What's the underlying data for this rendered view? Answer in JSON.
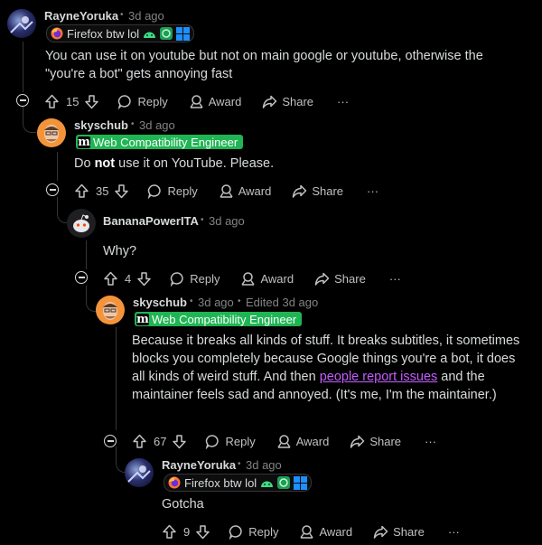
{
  "comments": [
    {
      "user": "RayneYoruka",
      "time": "3d ago",
      "flair_text": "Firefox btw lol",
      "text": "You can use it on youtube but not on main google or youtube, otherwise the \"you're a bot\" gets annoying fast",
      "votes": "15"
    },
    {
      "user": "skyschub",
      "time": "3d ago",
      "flair_letter": "m",
      "flair_text": "Web Compatibility Engineer",
      "text_before": "Do ",
      "text_bold": "not",
      "text_after": " use it on YouTube. Please.",
      "votes": "35"
    },
    {
      "user": "BananaPowerITA",
      "time": "3d ago",
      "text": "Why?",
      "votes": "4"
    },
    {
      "user": "skyschub",
      "time": "3d ago",
      "edited": "Edited 3d ago",
      "flair_letter": "m",
      "flair_text": "Web Compatibility Engineer",
      "text_before": "Because it breaks all kinds of stuff. It breaks subtitles, it sometimes blocks you completely because Google things you're a bot, it does all kinds of weird stuff. And then ",
      "link_text": "people report issues",
      "text_after": " and the maintainer feels sad and annoyed. (It's me, I'm the maintainer.)",
      "votes": "67"
    },
    {
      "user": "RayneYoruka",
      "time": "3d ago",
      "flair_text": "Firefox btw lol",
      "text": "Gotcha",
      "votes": "9"
    }
  ],
  "actions": {
    "reply": "Reply",
    "award": "Award",
    "share": "Share",
    "more": "···"
  },
  "separator": "•",
  "colors": {
    "background": "#000000",
    "flair_green": "#1fb554",
    "link": "#c55cff",
    "meta": "#818384"
  }
}
